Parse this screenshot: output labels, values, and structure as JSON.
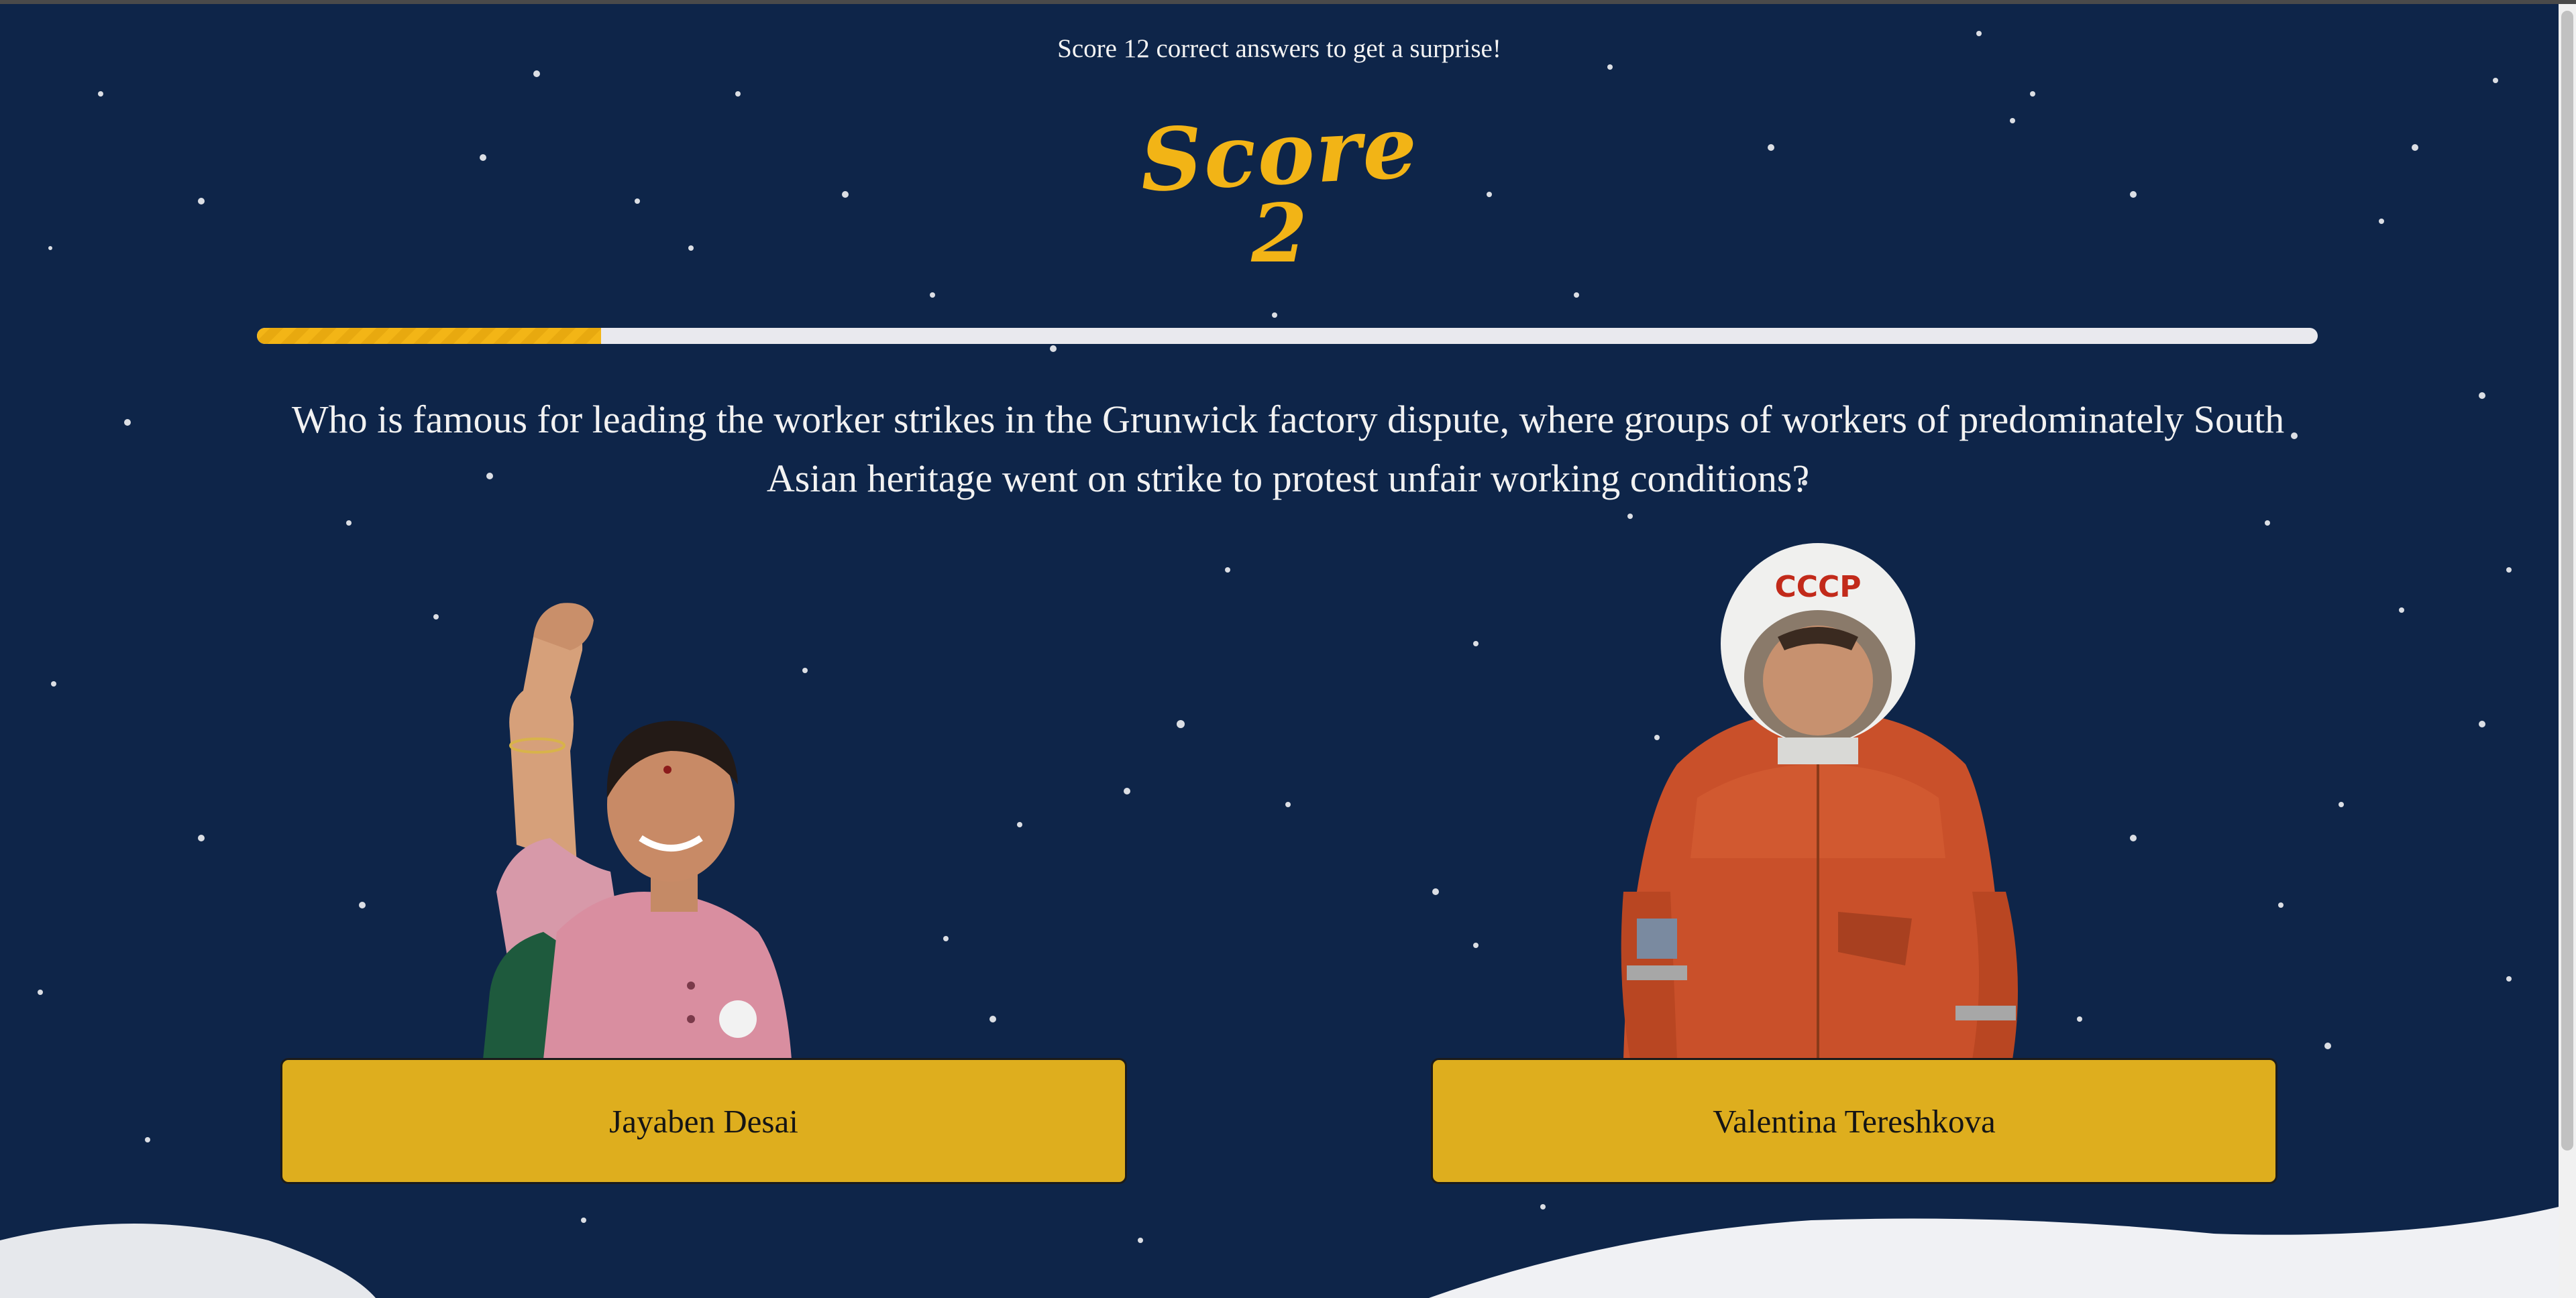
{
  "header": {
    "hint": "Score 12 correct answers to get a surprise!",
    "score_label": "Score",
    "score_value": "2"
  },
  "progress": {
    "value": 0.167,
    "max_label": "12"
  },
  "question": {
    "text": "Who is famous for leading the worker strikes in the Grunwick factory dispute, where groups of workers of predominately South Asian heritage went on strike to protest unfair working conditions?"
  },
  "answers": [
    {
      "label": "Jayaben Desai",
      "image": "woman-raised-fist-photo"
    },
    {
      "label": "Valentina Tereshkova",
      "image": "cosmonaut-orange-suit-photo",
      "helmet_text": "CCCP"
    }
  ],
  "colors": {
    "background": "#0e2549",
    "accent": "#f2b416",
    "button": "#deae1e",
    "text": "#f2f2f2"
  }
}
